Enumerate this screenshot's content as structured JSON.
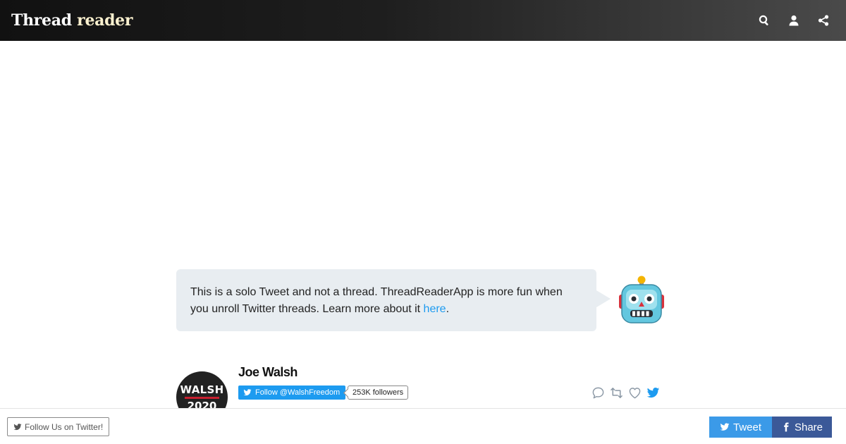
{
  "header": {
    "brand_part1": "Thread",
    "brand_part2": "reader",
    "icons": [
      "search-icon",
      "user-icon",
      "share-icon"
    ]
  },
  "notice": {
    "text": "This is a solo Tweet and not a thread. ThreadReaderApp is more fun when you unroll Twitter threads. Learn more about it ",
    "link_text": "here",
    "suffix": ".",
    "mascot": "robot-icon"
  },
  "tweet": {
    "author_name": "Joe Walsh",
    "avatar_line1": "WALSH",
    "avatar_line2": "2020",
    "follow_label": "Follow @WalshFreedom",
    "followers_count": "253K followers",
    "action_icons": [
      "reply-icon",
      "retweet-icon",
      "like-icon",
      "twitter-bird-icon"
    ]
  },
  "footer": {
    "follow_us_label": "Follow Us on Twitter!",
    "tweet_label": "Tweet",
    "share_label": "Share"
  },
  "colors": {
    "twitter_blue": "#1d9bf0",
    "facebook_blue": "#3b5998",
    "bubble_bg": "#e8edf1"
  }
}
